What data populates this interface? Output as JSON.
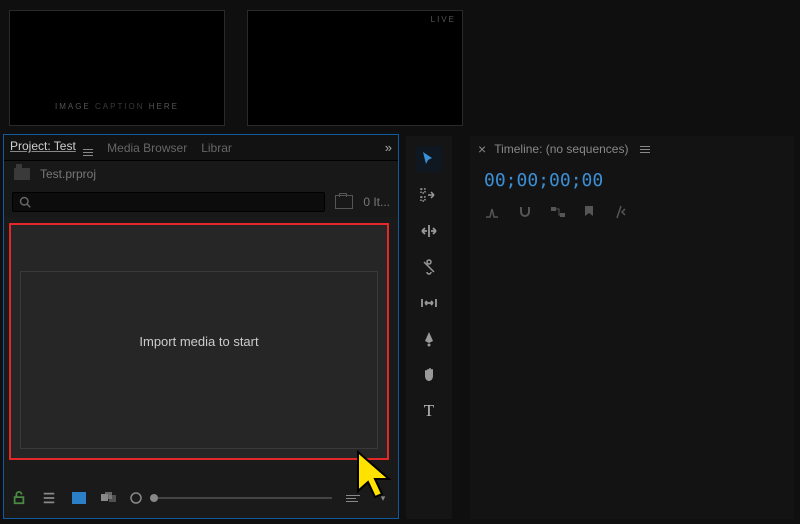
{
  "preview": {
    "thumb1_caption_pre": "IMAGE ",
    "thumb1_caption_mid": "CAPTION ",
    "thumb1_caption_post": "HERE",
    "thumb2_badge": "LIVE"
  },
  "panel": {
    "tabs": {
      "project": "Project: Test",
      "media_browser": "Media Browser",
      "libraries": "Librar"
    },
    "overflow_glyph": "»",
    "filename": "Test.prproj",
    "item_count": "0 It...",
    "import_hint": "Import media to start"
  },
  "timeline": {
    "close_glyph": "×",
    "title": "Timeline: (no sequences)",
    "timecode": "00;00;00;00"
  },
  "icons": {
    "selection": "selection-tool",
    "track_select": "track-select-forward-tool",
    "ripple": "ripple-edit-tool",
    "razor": "razor-tool",
    "slip": "slip-tool",
    "pen": "pen-tool",
    "hand": "hand-tool",
    "type": "type-tool"
  }
}
